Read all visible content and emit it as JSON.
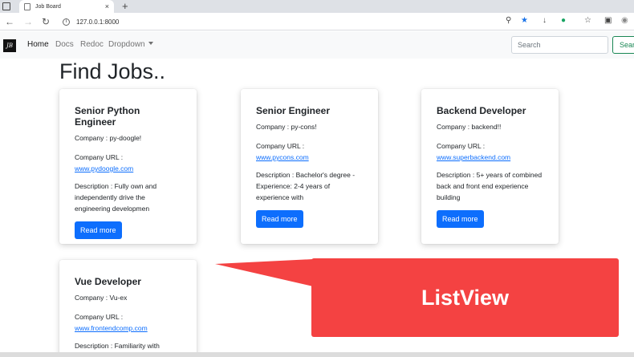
{
  "browser": {
    "tab_title": "Job Board",
    "tab_close": "×",
    "new_tab": "+",
    "url": "127.0.0.1:8000",
    "info_icon": "i"
  },
  "navbar": {
    "brand": "JB",
    "links": [
      "Home",
      "Docs",
      "Redoc",
      "Dropdown"
    ],
    "search_placeholder": "Search",
    "search_button": "Search"
  },
  "page": {
    "title": "Find Jobs.."
  },
  "jobs": [
    {
      "title": "Senior Python Engineer",
      "company": "Company : py-doogle!",
      "url_label": "Company URL :",
      "url": "www.pydoogle.com",
      "description": "Description : Fully own and independently drive the engineering developmen",
      "button": "Read more"
    },
    {
      "title": "Senior Engineer",
      "company": "Company : py-cons!",
      "url_label": "Company URL :",
      "url": "www.pycons.com",
      "description": "Description : Bachelor's degree - Experience: 2-4 years of experience with",
      "button": "Read more"
    },
    {
      "title": "Backend Developer",
      "company": "Company : backend!!",
      "url_label": "Company URL :",
      "url": "www.superbackend.com",
      "description": "Description : 5+ years of combined back and front end experience building",
      "button": "Read more"
    },
    {
      "title": "Vue Developer",
      "company": "Company : Vu-ex",
      "url_label": "Company URL :",
      "url": "www.frontendcomp.com",
      "description": "Description : Familiarity with",
      "button": ""
    }
  ],
  "callout": {
    "text": "ListView",
    "color": "#f44242"
  },
  "colors": {
    "primary": "#0d6efd",
    "success": "#198754",
    "navbar_bg": "#f8f9fa"
  }
}
